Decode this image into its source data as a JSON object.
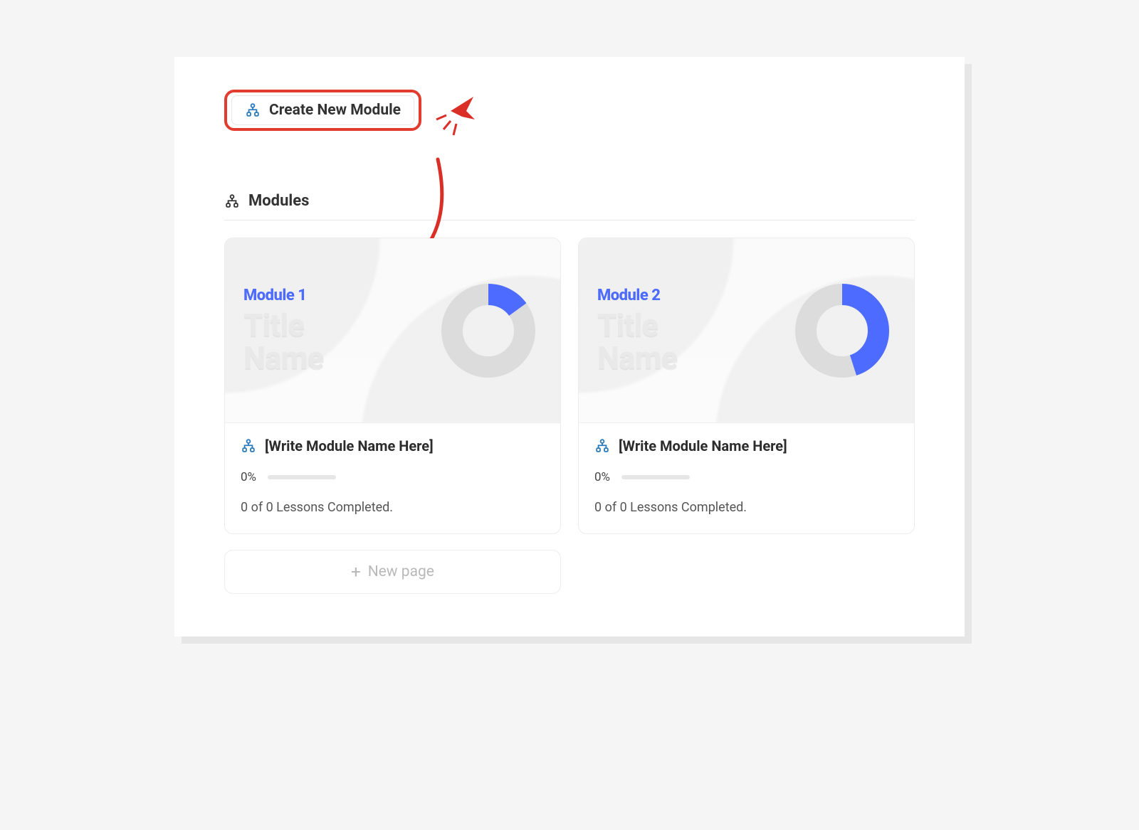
{
  "accent_blue": "#4d6bff",
  "icon_blue": "#2c7bbb",
  "create_button": {
    "label": "Create New Module"
  },
  "section_header": "Modules",
  "new_page_label": "New page",
  "modules": [
    {
      "cover_label": "Module 1",
      "cover_title_line1": "Title",
      "cover_title_line2": "Name",
      "donut_percent": 15,
      "name": "[Write Module Name Here]",
      "progress_text": "0%",
      "lessons_text": "0 of 0 Lessons Completed."
    },
    {
      "cover_label": "Module 2",
      "cover_title_line1": "Title",
      "cover_title_line2": "Name",
      "donut_percent": 45,
      "name": "[Write Module Name Here]",
      "progress_text": "0%",
      "lessons_text": "0 of 0 Lessons Completed."
    }
  ]
}
